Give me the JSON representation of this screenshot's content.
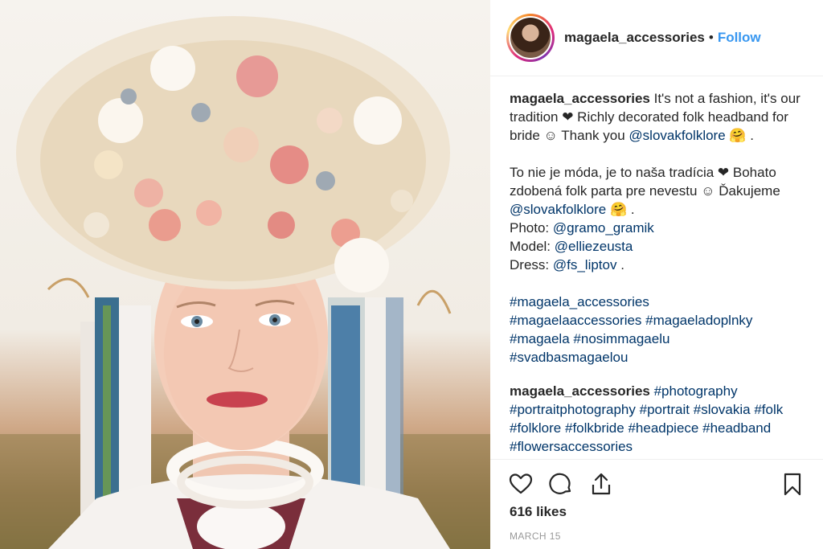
{
  "post": {
    "image_alt": "Bride wearing a richly decorated Slovak folk flower headband",
    "header": {
      "username": "magaela_accessories",
      "separator": "•",
      "follow_label": "Follow"
    },
    "caption": {
      "username": "magaela_accessories",
      "en_text": "It's not a fashion, it's our tradition ❤ Richly decorated folk headband for bride ☺ Thank you",
      "en_mention": "@slovakfolklore",
      "en_tail": "🤗 .",
      "sk_text": "To nie je móda, je to naša tradícia ❤ Bohato zdobená folk parta pre nevestu ☺ Ďakujeme",
      "sk_mention": "@slovakfolklore",
      "sk_tail": "🤗 .",
      "photo_label": "Photo:",
      "photo_mention": "@gramo_gramik",
      "model_label": "Model:",
      "model_mention": "@elliezeusta",
      "dress_label": "Dress:",
      "dress_mention": "@fs_liptov",
      "dress_tail": ".",
      "hashtags": [
        "#magaela_accessories",
        "#magaelaaccessories",
        "#magaeladoplnky",
        "#magaela",
        "#nosimmagaelu",
        "#svadbasmagaelou"
      ]
    },
    "comment": {
      "username": "magaela_accessories",
      "hashtags": [
        "#photography",
        "#portraitphotography",
        "#portrait",
        "#slovakia",
        "#folk",
        "#folklore",
        "#folkbride",
        "#headpiece",
        "#headband",
        "#flowersaccessories"
      ]
    },
    "actions": {
      "like": "heart-icon",
      "comment": "comment-icon",
      "share": "share-icon",
      "save": "bookmark-icon"
    },
    "likes": "616 likes",
    "date": "MARCH 15"
  }
}
